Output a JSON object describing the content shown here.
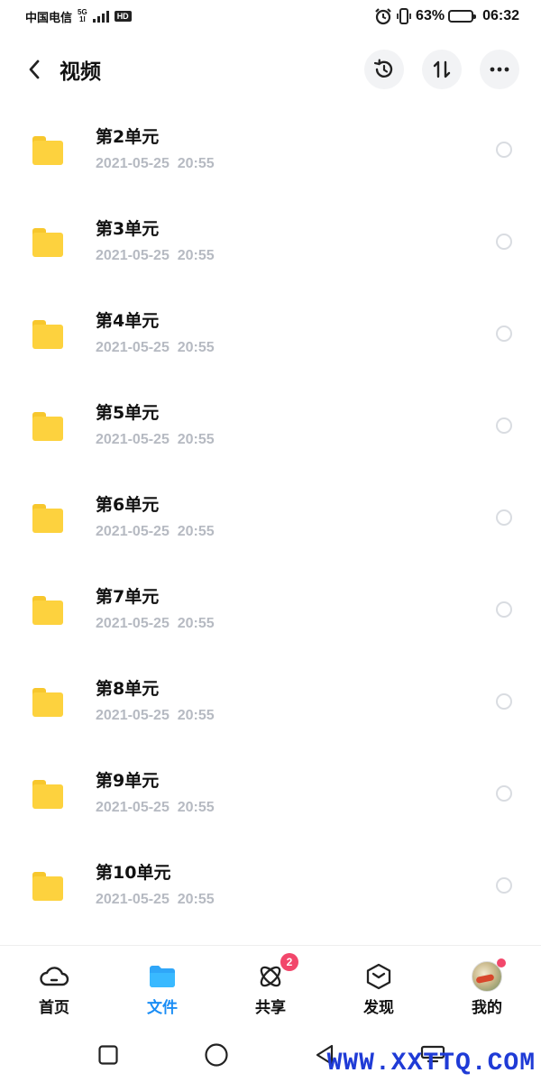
{
  "status_bar": {
    "carrier": "中国电信",
    "network": "5G",
    "network_sub": "1l",
    "hd": "HD",
    "battery_percent": "63%",
    "battery_level": 0.63,
    "time": "06:32"
  },
  "header": {
    "back_icon": "chevron-left-icon",
    "title": "视频",
    "actions": [
      {
        "name": "history-button",
        "icon": "history-icon"
      },
      {
        "name": "sort-button",
        "icon": "sort-icon"
      },
      {
        "name": "more-button",
        "icon": "more-icon"
      }
    ]
  },
  "files": [
    {
      "name": "第2单元",
      "date": "2021-05-25  20:55"
    },
    {
      "name": "第3单元",
      "date": "2021-05-25  20:55"
    },
    {
      "name": "第4单元",
      "date": "2021-05-25  20:55"
    },
    {
      "name": "第5单元",
      "date": "2021-05-25  20:55"
    },
    {
      "name": "第6单元",
      "date": "2021-05-25  20:55"
    },
    {
      "name": "第7单元",
      "date": "2021-05-25  20:55"
    },
    {
      "name": "第8单元",
      "date": "2021-05-25  20:55"
    },
    {
      "name": "第9单元",
      "date": "2021-05-25  20:55"
    },
    {
      "name": "第10单元",
      "date": "2021-05-25  20:55"
    }
  ],
  "bottom_nav": {
    "items": [
      {
        "label": "首页",
        "icon": "cloud-icon",
        "active": false
      },
      {
        "label": "文件",
        "icon": "folder-icon",
        "active": true
      },
      {
        "label": "共享",
        "icon": "share-orbit-icon",
        "active": false,
        "badge": "2"
      },
      {
        "label": "发现",
        "icon": "discover-icon",
        "active": false
      },
      {
        "label": "我的",
        "icon": "avatar",
        "active": false,
        "dot": true
      }
    ]
  },
  "system_nav": {
    "buttons": [
      "recent-apps-icon",
      "home-icon",
      "back-icon",
      "menu-icon"
    ]
  },
  "watermark": "WWW.XXTTQ.COM",
  "colors": {
    "accent": "#1a8df5",
    "folder": "#fdd23e",
    "badge": "#f2476b",
    "date_text": "#b6bac2"
  }
}
